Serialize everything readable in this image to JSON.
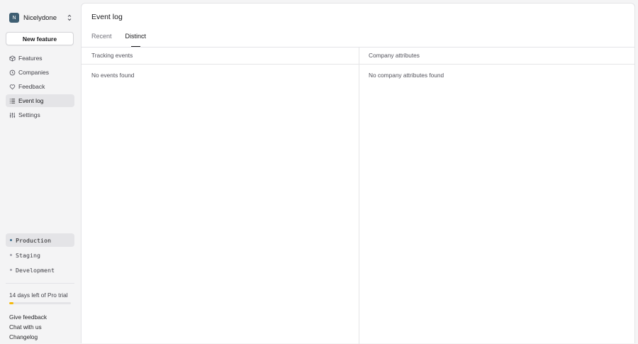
{
  "org": {
    "avatar_letter": "N",
    "name": "Nicelydone"
  },
  "sidebar": {
    "new_feature_label": "New feature",
    "nav": [
      {
        "label": "Features",
        "icon": "features-icon"
      },
      {
        "label": "Companies",
        "icon": "companies-icon"
      },
      {
        "label": "Feedback",
        "icon": "feedback-icon"
      },
      {
        "label": "Event log",
        "icon": "event-log-icon",
        "active": true
      },
      {
        "label": "Settings",
        "icon": "settings-icon"
      }
    ],
    "environments": [
      {
        "label": "Production",
        "active": true
      },
      {
        "label": "Staging"
      },
      {
        "label": "Development"
      }
    ],
    "trial": {
      "text": "14 days left of Pro trial",
      "progress": 0.07,
      "accent": "#f5b90b"
    },
    "footer_links": [
      "Give feedback",
      "Chat with us",
      "Changelog"
    ]
  },
  "main": {
    "title": "Event log",
    "tabs": [
      {
        "label": "Recent"
      },
      {
        "label": "Distinct",
        "active": true
      }
    ],
    "columns": [
      {
        "header": "Tracking events",
        "empty_text": "No events found"
      },
      {
        "header": "Company attributes",
        "empty_text": "No company attributes found"
      }
    ]
  }
}
